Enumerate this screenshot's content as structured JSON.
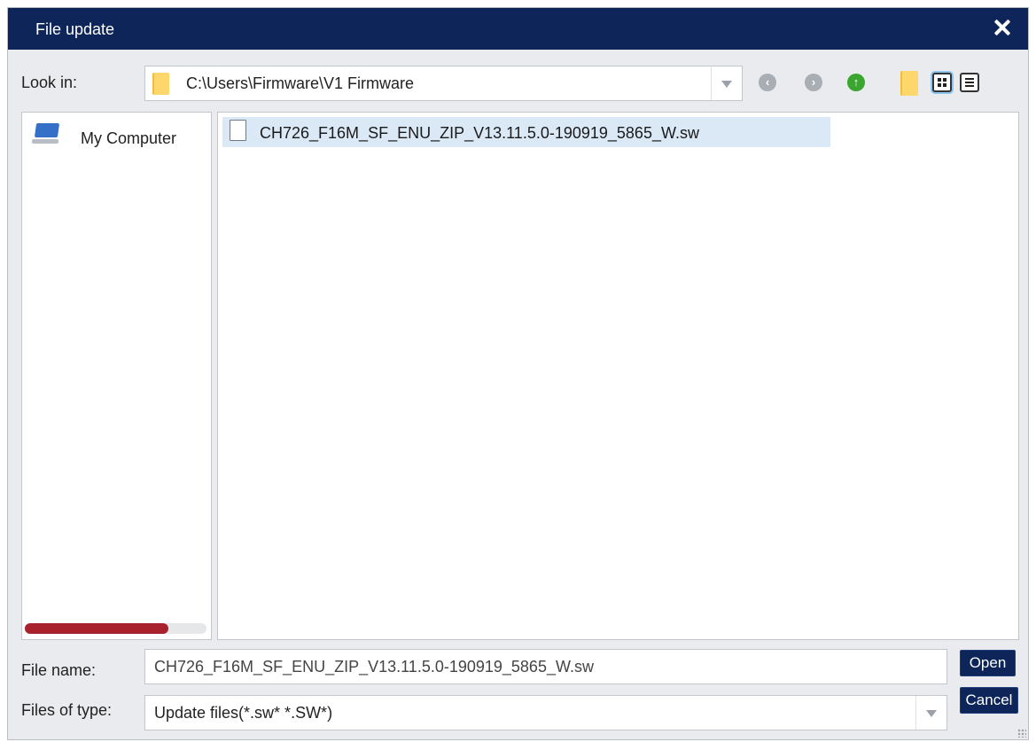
{
  "dialog": {
    "title": "File update"
  },
  "look_in": {
    "label": "Look in:",
    "path": "C:\\Users\\Firmware\\V1 Firmware"
  },
  "toolbar": {
    "icons": [
      "back-icon",
      "forward-icon",
      "up-folder-icon",
      "new-folder-icon",
      "list-view-icon",
      "details-view-icon"
    ]
  },
  "places": {
    "items": [
      {
        "label": "My Computer",
        "icon": "computer-icon"
      }
    ]
  },
  "files": {
    "items": [
      {
        "name": "CH726_F16M_SF_ENU_ZIP_V13.11.5.0-190919_5865_W.sw",
        "selected": true,
        "icon": "document-icon"
      }
    ]
  },
  "file_name": {
    "label": "File name:",
    "value": "CH726_F16M_SF_ENU_ZIP_V13.11.5.0-190919_5865_W.sw"
  },
  "file_type": {
    "label": "Files of type:",
    "value": "Update files(*.sw* *.SW*)"
  },
  "buttons": {
    "open": "Open",
    "cancel": "Cancel"
  },
  "colors": {
    "titlebar": "#0d2558",
    "button": "#0d2558",
    "selection": "#dbe9f7",
    "scroll_thumb": "#a8222e"
  }
}
